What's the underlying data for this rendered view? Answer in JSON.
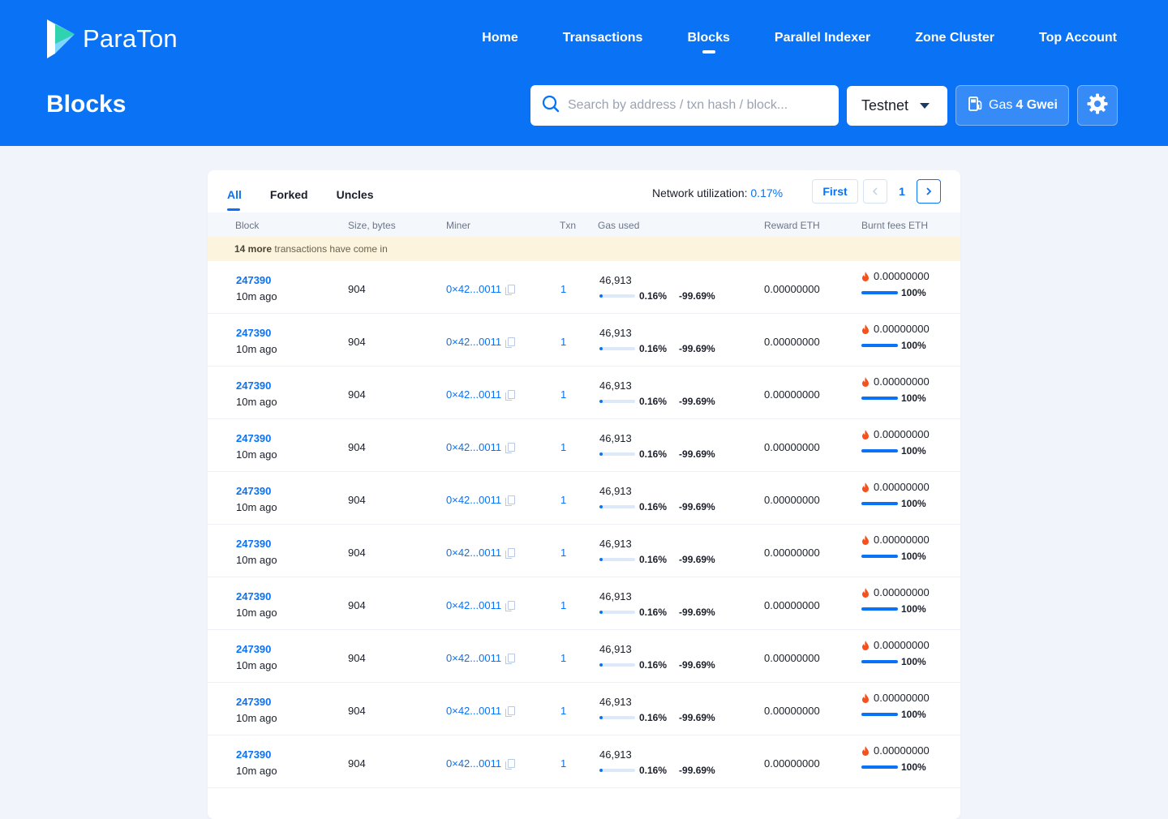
{
  "brand": {
    "name": "ParaTon"
  },
  "nav": [
    {
      "label": "Home"
    },
    {
      "label": "Transactions"
    },
    {
      "label": "Blocks"
    },
    {
      "label": "Parallel Indexer"
    },
    {
      "label": "Zone Cluster"
    },
    {
      "label": "Top Account"
    }
  ],
  "active_nav": "Blocks",
  "page_title": "Blocks",
  "search": {
    "placeholder": "Search by address / txn hash / block..."
  },
  "network": {
    "selected": "Testnet"
  },
  "gas": {
    "label": "Gas",
    "value": "4 Gwei"
  },
  "icons": {
    "search": "search-icon",
    "caret": "chevron-down-icon",
    "gas": "gas-pump-icon",
    "settings": "gear-icon",
    "copy": "copy-icon",
    "fire": "fire-icon"
  },
  "colors": {
    "brand": "#0a72f5",
    "notice_bg": "#fcf4dc",
    "fire": "#f4511e"
  },
  "tabs": [
    {
      "label": "All"
    },
    {
      "label": "Forked"
    },
    {
      "label": "Uncles"
    }
  ],
  "utilization": {
    "label": "Network utilization:",
    "value": "0.17%"
  },
  "pager": {
    "first": "First",
    "current": "1"
  },
  "columns": {
    "block": "Block",
    "size": "Size, bytes",
    "miner": "Miner",
    "txn": "Txn",
    "gas": "Gas used",
    "reward": "Reward ETH",
    "burnt": "Burnt fees ETH"
  },
  "notice": {
    "count": "14 more",
    "text": " transactions have come in"
  },
  "rows": [
    {
      "block": "247390",
      "age": "10m ago",
      "size": "904",
      "miner": "0×42...0011",
      "txn": "1",
      "gas_used": "46,913",
      "gas_pct": "0.16%",
      "gas_fill": 0.0016,
      "gas_delta": "-99.69%",
      "reward": "0.00000000",
      "burnt": "0.00000000",
      "burnt_pct": "100%"
    },
    {
      "block": "247390",
      "age": "10m ago",
      "size": "904",
      "miner": "0×42...0011",
      "txn": "1",
      "gas_used": "46,913",
      "gas_pct": "0.16%",
      "gas_fill": 0.0016,
      "gas_delta": "-99.69%",
      "reward": "0.00000000",
      "burnt": "0.00000000",
      "burnt_pct": "100%"
    },
    {
      "block": "247390",
      "age": "10m ago",
      "size": "904",
      "miner": "0×42...0011",
      "txn": "1",
      "gas_used": "46,913",
      "gas_pct": "0.16%",
      "gas_fill": 0.0016,
      "gas_delta": "-99.69%",
      "reward": "0.00000000",
      "burnt": "0.00000000",
      "burnt_pct": "100%"
    },
    {
      "block": "247390",
      "age": "10m ago",
      "size": "904",
      "miner": "0×42...0011",
      "txn": "1",
      "gas_used": "46,913",
      "gas_pct": "0.16%",
      "gas_fill": 0.0016,
      "gas_delta": "-99.69%",
      "reward": "0.00000000",
      "burnt": "0.00000000",
      "burnt_pct": "100%"
    },
    {
      "block": "247390",
      "age": "10m ago",
      "size": "904",
      "miner": "0×42...0011",
      "txn": "1",
      "gas_used": "46,913",
      "gas_pct": "0.16%",
      "gas_fill": 0.0016,
      "gas_delta": "-99.69%",
      "reward": "0.00000000",
      "burnt": "0.00000000",
      "burnt_pct": "100%"
    },
    {
      "block": "247390",
      "age": "10m ago",
      "size": "904",
      "miner": "0×42...0011",
      "txn": "1",
      "gas_used": "46,913",
      "gas_pct": "0.16%",
      "gas_fill": 0.0016,
      "gas_delta": "-99.69%",
      "reward": "0.00000000",
      "burnt": "0.00000000",
      "burnt_pct": "100%"
    },
    {
      "block": "247390",
      "age": "10m ago",
      "size": "904",
      "miner": "0×42...0011",
      "txn": "1",
      "gas_used": "46,913",
      "gas_pct": "0.16%",
      "gas_fill": 0.0016,
      "gas_delta": "-99.69%",
      "reward": "0.00000000",
      "burnt": "0.00000000",
      "burnt_pct": "100%"
    },
    {
      "block": "247390",
      "age": "10m ago",
      "size": "904",
      "miner": "0×42...0011",
      "txn": "1",
      "gas_used": "46,913",
      "gas_pct": "0.16%",
      "gas_fill": 0.0016,
      "gas_delta": "-99.69%",
      "reward": "0.00000000",
      "burnt": "0.00000000",
      "burnt_pct": "100%"
    },
    {
      "block": "247390",
      "age": "10m ago",
      "size": "904",
      "miner": "0×42...0011",
      "txn": "1",
      "gas_used": "46,913",
      "gas_pct": "0.16%",
      "gas_fill": 0.0016,
      "gas_delta": "-99.69%",
      "reward": "0.00000000",
      "burnt": "0.00000000",
      "burnt_pct": "100%"
    },
    {
      "block": "247390",
      "age": "10m ago",
      "size": "904",
      "miner": "0×42...0011",
      "txn": "1",
      "gas_used": "46,913",
      "gas_pct": "0.16%",
      "gas_fill": 0.0016,
      "gas_delta": "-99.69%",
      "reward": "0.00000000",
      "burnt": "0.00000000",
      "burnt_pct": "100%"
    }
  ]
}
